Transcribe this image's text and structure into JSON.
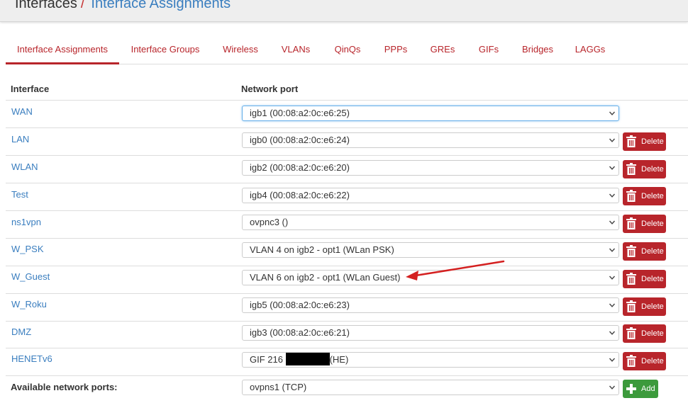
{
  "header": {
    "root": "Interfaces",
    "separator": "/",
    "current": "Interface Assignments"
  },
  "tabs": [
    {
      "label": "Interface Assignments",
      "active": true
    },
    {
      "label": "Interface Groups"
    },
    {
      "label": "Wireless"
    },
    {
      "label": "VLANs"
    },
    {
      "label": "QinQs"
    },
    {
      "label": "PPPs"
    },
    {
      "label": "GREs"
    },
    {
      "label": "GIFs"
    },
    {
      "label": "Bridges"
    },
    {
      "label": "LAGGs"
    }
  ],
  "table": {
    "col_interface": "Interface",
    "col_network_port": "Network port",
    "rows": [
      {
        "interface": "WAN",
        "port": "igb1 (00:08:a2:0c:e6:25)"
      },
      {
        "interface": "LAN",
        "port": "igb0 (00:08:a2:0c:e6:24)",
        "action": "Delete"
      },
      {
        "interface": "WLAN",
        "port": "igb2 (00:08:a2:0c:e6:20)",
        "action": "Delete"
      },
      {
        "interface": "Test",
        "port": "igb4 (00:08:a2:0c:e6:22)",
        "action": "Delete"
      },
      {
        "interface": "ns1vpn",
        "port": "ovpnc3 ()",
        "action": "Delete"
      },
      {
        "interface": "W_PSK",
        "port": "VLAN 4 on igb2 - opt1 (WLan PSK)",
        "action": "Delete"
      },
      {
        "interface": "W_Guest",
        "port": "VLAN 6 on igb2 - opt1 (WLan Guest)",
        "action": "Delete"
      },
      {
        "interface": "W_Roku",
        "port": "igb5 (00:08:a2:0c:e6:23)",
        "action": "Delete"
      },
      {
        "interface": "DMZ",
        "port": "igb3 (00:08:a2:0c:e6:21)",
        "action": "Delete"
      },
      {
        "interface": "HENETv6",
        "port_prefix": "GIF 216",
        "port_suffix": "(HE)",
        "action": "Delete"
      }
    ],
    "available": {
      "label": "Available network ports:",
      "port": "ovpns1 (TCP)",
      "action": "Add"
    }
  },
  "colors": {
    "accent_red": "#b8252b",
    "link_blue": "#3a7ebf",
    "add_green": "#3c9a3c",
    "annotation_arrow": "#d42020"
  },
  "icons": {
    "delete": "trash-icon",
    "add": "plus-icon",
    "select": "chevron-down-icon"
  }
}
